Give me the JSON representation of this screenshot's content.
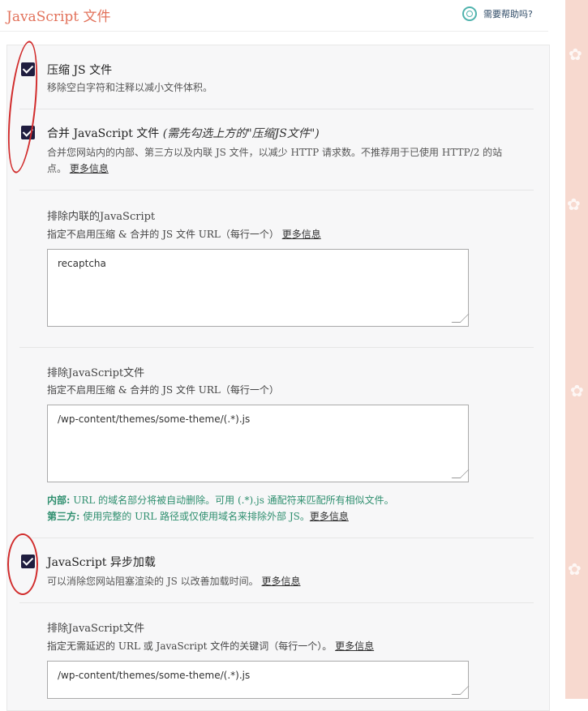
{
  "header": {
    "title": "JavaScript 文件",
    "help_label": "需要帮助吗?"
  },
  "options": {
    "minify": {
      "label": "压缩 JS 文件",
      "desc": "移除空白字符和注释以减小文件体积。"
    },
    "combine": {
      "label": "合并 JavaScript 文件",
      "note": "(需先勾选上方的\"压缩JS文件\")",
      "desc_line1": "合并您网站内的内部、第三方以及内联 JS 文件，以减少 HTTP 请求数。不推荐用于已使用 HTTP/2 的站",
      "desc_line2": "点。",
      "more": "更多信息"
    },
    "exclude_inline": {
      "title": "排除内联的JavaScript",
      "desc": "指定不启用压缩 & 合并的 JS 文件 URL（每行一个）",
      "more": "更多信息",
      "value": "recaptcha"
    },
    "exclude_files": {
      "title": "排除JavaScript文件",
      "desc": "指定不启用压缩 & 合并的 JS 文件 URL（每行一个）",
      "value": "/wp-content/themes/some-theme/(.*).js",
      "internal_label": "内部:",
      "internal_text": " URL 的域名部分将被自动删除。可用 (.*).js 通配符来匹配所有相似文件。",
      "third_label": "第三方:",
      "third_text": " 使用完整的 URL 路径或仅使用域名来排除外部 JS。",
      "more": "更多信息"
    },
    "defer": {
      "label": "JavaScript 异步加载",
      "desc": "可以消除您网站阻塞渲染的 JS 以改善加载时间。",
      "more": "更多信息"
    },
    "defer_exclude": {
      "title": "排除JavaScript文件",
      "desc": "指定无需延迟的 URL 或 JavaScript 文件的关键词（每行一个）。",
      "more": "更多信息",
      "value": "/wp-content/themes/some-theme/(.*).js"
    }
  },
  "icons": {
    "help": "help-lifebuoy-icon",
    "check": "checkmark-icon"
  },
  "colors": {
    "title": "#e2725b",
    "checkbox": "#1f1d3f",
    "green": "#2f8f6f",
    "annotation": "#d12b2b"
  }
}
